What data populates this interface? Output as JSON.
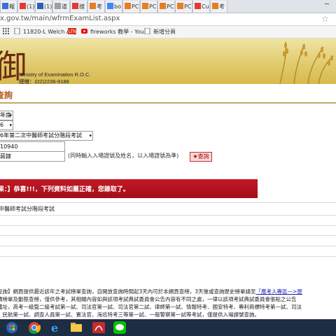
{
  "browser": {
    "tabs": [
      {
        "label": "報",
        "color": "#3b6fd8"
      },
      {
        "label": "(1)",
        "color": "#e53935"
      },
      {
        "label": "(1)",
        "color": "#2f5fb3"
      },
      {
        "label": "道",
        "color": "#9e9e9e"
      },
      {
        "label": "搜",
        "color": "#e53935"
      },
      {
        "label": "考",
        "color": "#e67e22"
      },
      {
        "label": "bo",
        "color": "#4285f4"
      },
      {
        "label": "PC",
        "color": "#e67e22"
      },
      {
        "label": "PC",
        "color": "#e67e22"
      },
      {
        "label": "PC",
        "color": "#e67e22"
      },
      {
        "label": "PC",
        "color": "#e67e22"
      },
      {
        "label": "Cu",
        "color": "#e53935"
      },
      {
        "label": "考",
        "color": "#e67e22"
      }
    ],
    "tab_close_glyph": "×",
    "window_min": "─",
    "url": "x.gov.tw/main/wfrmExamList.aspx",
    "star_glyph": "☆",
    "bookmarks": [
      {
        "label": "",
        "icon": "apps-icon"
      },
      {
        "label": "11820-L Welch Ally",
        "icon": "page-icon"
      },
      {
        "label": "",
        "icon": "ltn-icon"
      },
      {
        "label": "fireworks 教學 - You",
        "icon": "youtube-icon"
      },
      {
        "label": "新增分頁",
        "icon": "page-icon"
      }
    ]
  },
  "banner": {
    "logo_char": "御",
    "ministry": "Ministry of Examination R.O.C.",
    "phone": "總機：(02)2236-9188"
  },
  "page": {
    "title": "查詢",
    "year_select": "年度",
    "month_select": "6",
    "exam_select": "6年第二次中醫師考試分階段考試",
    "exam_no_value": "10940",
    "name_value": "蔣鎵",
    "hint": "(同時輸入入場證號及姓名，以入場證號為準)",
    "query_button": "★查詢",
    "result_banner": "果：】恭喜!!!，下列資料如屬正確，您錄取了。",
    "result_exam": "中醫師考試分階段考試",
    "notes": [
      {
        "text": "查詢】網頁提供最近該年之考試榜單查詢，自開放查詢時間起3天內可於本網頁查榜，3天後或查詢歷史榜單請至",
        "link": "「應考人專區—>歷"
      },
      {
        "text": "續榜單及動態查榜，僅供參考，其相關內容如與該項考試典試委員會公告內容有不同之處，一律以該項考試典試委員會張貼之公告",
        "link": ""
      },
      {
        "text": "鐵址，高考一級暨二級考試第一試、司法官第一試、司法官第二試、律師第一試、情報特考、國安特考、專利商標特考第一試、司法",
        "link": ""
      },
      {
        "text": "、民航第一試、調查人員第一試、置法官、海巡特考三等第一試、一般警察第一試等考試，僅提供入場證號查詢。",
        "link": ""
      }
    ]
  },
  "taskbar": {
    "apps": [
      "start-orb-icon",
      "chrome-icon",
      "ie-icon",
      "explorer-icon",
      "acrobat-icon",
      "line-icon"
    ]
  }
}
